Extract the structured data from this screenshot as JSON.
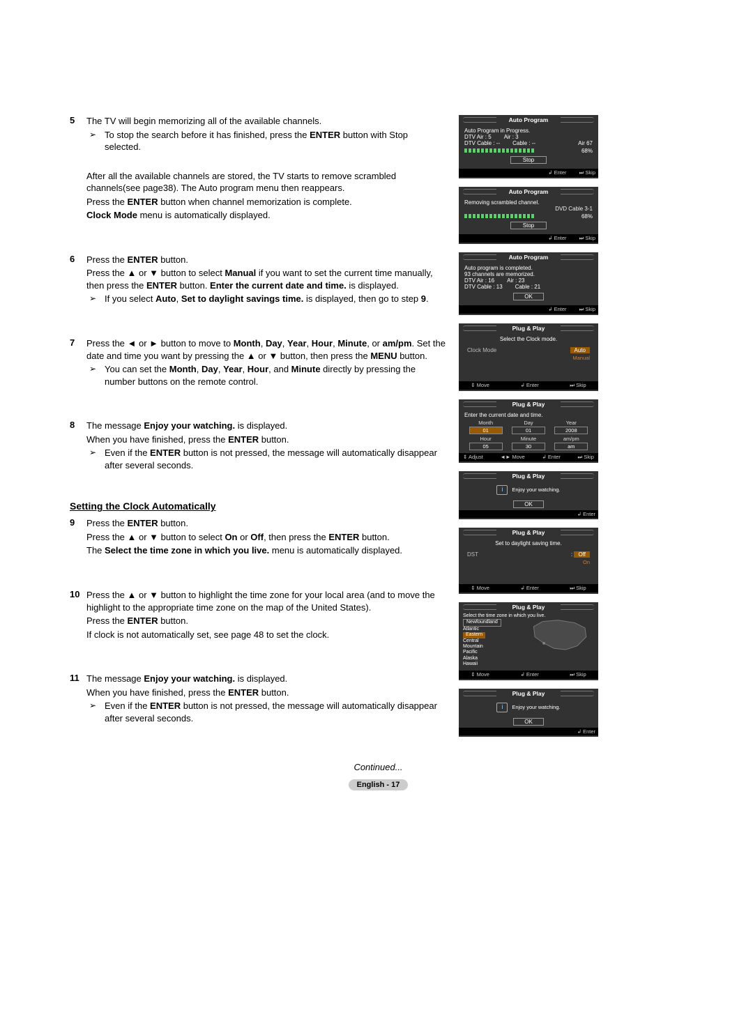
{
  "steps": {
    "s5": {
      "num": "5",
      "p1a": "The TV will begin memorizing all of the available channels.",
      "li1a": "To stop the search before it has finished, press the ",
      "li1b": "ENTER",
      "li1c": " button with Stop selected.",
      "p2": "After all the available channels are stored, the TV starts to remove scrambled channels(see page38). The Auto program menu then reappears.",
      "p3a": "Press the ",
      "p3b": "ENTER",
      "p3c": " button when channel memorization is complete.",
      "p4a": "Clock Mode",
      "p4b": " menu is automatically displayed."
    },
    "s6": {
      "num": "6",
      "p1a": "Press the ",
      "p1b": "ENTER",
      "p1c": " button.",
      "p2a": "Press the ▲ or ▼ button to select ",
      "p2b": "Manual",
      "p2c": " if you want to set the current time manually, then press the ",
      "p2d": "ENTER",
      "p2e": " button. ",
      "p2f": "Enter the current date and time.",
      "p2g": " is displayed.",
      "li1a": "If you select ",
      "li1b": "Auto",
      "li1c": ", ",
      "li1d": "Set to daylight savings time.",
      "li1e": " is displayed, then go to step ",
      "li1f": "9",
      "li1g": "."
    },
    "s7": {
      "num": "7",
      "p1a": "Press the ◄ or ► button to move to ",
      "p1b": "Month",
      "p1c": ", ",
      "p1d": "Day",
      "p1e": ", ",
      "p1f": "Year",
      "p1g": ", ",
      "p1h": "Hour",
      "p1i": ", ",
      "p1j": "Minute",
      "p1k": ", or ",
      "p1l": "am/pm",
      "p1m": ". Set the date and time you want by pressing the ▲ or ▼ button, then press the ",
      "p1n": "MENU",
      "p1o": " button.",
      "li1a": "You can set the ",
      "li1b": "Month",
      "li1c": ", ",
      "li1d": "Day",
      "li1e": ", ",
      "li1f": "Year",
      "li1g": ", ",
      "li1h": "Hour",
      "li1i": ", and ",
      "li1j": "Minute",
      "li1k": " directly by pressing the number buttons on the remote control."
    },
    "s8": {
      "num": "8",
      "p1a": "The message ",
      "p1b": "Enjoy your watching.",
      "p1c": " is displayed.",
      "p2a": "When you have finished, press the ",
      "p2b": "ENTER",
      "p2c": " button.",
      "li1a": "Even if the ",
      "li1b": "ENTER",
      "li1c": " button is not pressed, the message will automatically disappear after several seconds."
    },
    "s9": {
      "num": "9",
      "p1a": "Press the ",
      "p1b": "ENTER",
      "p1c": " button.",
      "p2a": "Press the ▲ or ▼ button to select ",
      "p2b": "On",
      "p2c": " or ",
      "p2d": "Off",
      "p2e": ", then press the ",
      "p2f": "ENTER",
      "p2g": " button.",
      "p3a": "The ",
      "p3b": "Select the time zone in which you live.",
      "p3c": " menu is automatically displayed."
    },
    "s10": {
      "num": "10",
      "p1": "Press the ▲ or ▼ button to highlight the time zone for your local area (and to move the highlight to the appropriate time zone on the map of the United States).",
      "p2a": "Press the ",
      "p2b": "ENTER",
      "p2c": " button.",
      "p3": "If clock is not automatically set, see page 48 to set the clock."
    },
    "s11": {
      "num": "11",
      "p1a": "The message ",
      "p1b": "Enjoy your watching.",
      "p1c": " is displayed.",
      "p2a": "When you have finished, press the ",
      "p2b": "ENTER",
      "p2c": " button.",
      "li1a": "Even if the ",
      "li1b": "ENTER",
      "li1c": " button is not pressed, the message will automatically disappear after several seconds."
    }
  },
  "section_title": "Setting the Clock Automatically",
  "continued": "Continued...",
  "page_footer": "English - 17",
  "osd": {
    "p1": {
      "title": "Auto Program",
      "l1": "Auto Program in Progress.",
      "dtvair": "DTV Air : 5",
      "air": "Air : 3",
      "dtvcable": "DTV Cable : --",
      "cable": "Cable : --",
      "airnum": "Air   67",
      "pct": "68%",
      "stop": "Stop",
      "f1": "↲ Enter",
      "f2": "⏭ Skip"
    },
    "p2": {
      "title": "Auto Program",
      "l1": "Removing scrambled channel.",
      "ch": "DVD Cable 3-1",
      "pct": "68%",
      "stop": "Stop",
      "f1": "↲ Enter",
      "f2": "⏭ Skip"
    },
    "p3": {
      "title": "Auto Program",
      "l1": "Auto program is completed.",
      "l2": "93 channels are memorized.",
      "dtvair": "DTV Air : 16",
      "air": "Air : 23",
      "dtvcable": "DTV Cable : 13",
      "cable": "Cable : 21",
      "ok": "OK",
      "f1": "↲ Enter",
      "f2": "⏭ Skip"
    },
    "p4": {
      "title": "Plug & Play",
      "l1": "Select the Clock mode.",
      "lbl": "Clock Mode",
      "v1": "Auto",
      "v2": "Manual",
      "f1": "⇕ Move",
      "f2": "↲ Enter",
      "f3": "⏭ Skip"
    },
    "p5": {
      "title": "Plug & Play",
      "l1": "Enter the current date and time.",
      "month": "Month",
      "day": "Day",
      "year": "Year",
      "hour": "Hour",
      "minute": "Minute",
      "ampm": "am/pm",
      "vmonth": "01",
      "vday": "01",
      "vyear": "2008",
      "vhour": "05",
      "vminute": "30",
      "vampm": "am",
      "f1": "⇕ Adjust",
      "f2": "◄► Move",
      "f3": "↲ Enter",
      "f4": "⏭ Skip"
    },
    "p6": {
      "title": "Plug & Play",
      "msg": "Enjoy your watching.",
      "ok": "OK",
      "f1": "↲ Enter"
    },
    "p7": {
      "title": "Plug & Play",
      "l1": "Set to daylight saving time.",
      "lbl": "DST",
      "v1": "Off",
      "v2": "On",
      "f1": "⇕ Move",
      "f2": "↲ Enter",
      "f3": "⏭ Skip"
    },
    "p8": {
      "title": "Plug & Play",
      "l1": "Select the time zone in which you live.",
      "z1": "Newfoundland",
      "z2": "Atlantic",
      "z3": "Eastern",
      "z4": "Central",
      "z5": "Mountain",
      "z6": "Pacific",
      "z7": "Alaska",
      "z8": "Hawaii",
      "f1": "⇕ Move",
      "f2": "↲ Enter",
      "f3": "⏭ Skip"
    },
    "p9": {
      "title": "Plug & Play",
      "msg": "Enjoy your watching.",
      "ok": "OK",
      "f1": "↲ Enter"
    }
  }
}
